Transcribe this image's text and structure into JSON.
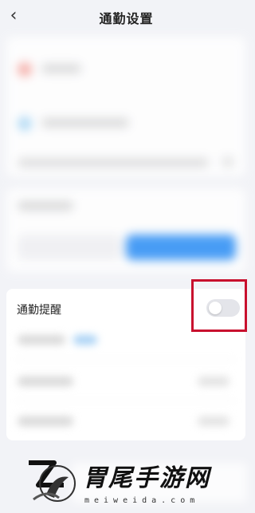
{
  "header": {
    "back_icon": "chevron-left-icon",
    "back_glyph": "‹",
    "title": "通勤设置"
  },
  "reminder": {
    "label": "通勤提醒",
    "toggle_on": false
  },
  "watermark": {
    "text": "胃尾手游网",
    "subtext": "meiweida.com"
  },
  "colors": {
    "accent_blue": "#2b8ef5",
    "highlight_red": "#c8102e",
    "page_bg": "#f2f3f7"
  }
}
